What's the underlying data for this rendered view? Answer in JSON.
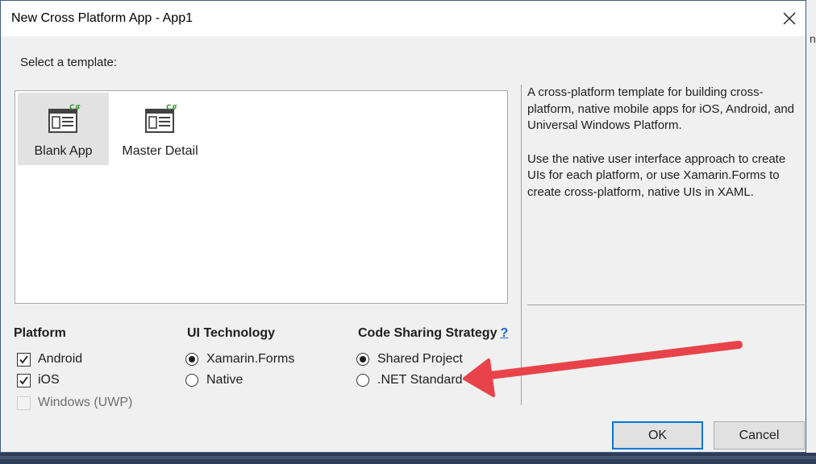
{
  "dialog": {
    "title": "New Cross Platform App - App1",
    "select_label": "Select a template:"
  },
  "templates": [
    {
      "label": "Blank App",
      "icon": "csharp-template-icon",
      "selected": true
    },
    {
      "label": "Master Detail",
      "icon": "csharp-template-icon",
      "selected": false
    }
  ],
  "description": {
    "paragraph1": "A cross-platform template for building cross-platform, native mobile apps for iOS, Android, and Universal Windows Platform.",
    "paragraph2": "Use the native user interface approach to create UIs for each platform, or use Xamarin.Forms to create cross-platform, native UIs in XAML."
  },
  "platform": {
    "title": "Platform",
    "options": [
      {
        "label": "Android",
        "checked": true,
        "enabled": true
      },
      {
        "label": "iOS",
        "checked": true,
        "enabled": true
      },
      {
        "label": "Windows (UWP)",
        "checked": false,
        "enabled": false
      }
    ]
  },
  "ui_technology": {
    "title": "UI Technology",
    "options": [
      {
        "label": "Xamarin.Forms",
        "selected": true
      },
      {
        "label": "Native",
        "selected": false
      }
    ]
  },
  "code_sharing": {
    "title": "Code Sharing Strategy",
    "help": "?",
    "options": [
      {
        "label": "Shared Project",
        "selected": true
      },
      {
        "label": ".NET Standard",
        "selected": false
      }
    ]
  },
  "buttons": {
    "ok": "OK",
    "cancel": "Cancel"
  },
  "background": {
    "right_edge_text": "n"
  },
  "colors": {
    "annotation_arrow": "#e8434a",
    "link": "#1e64c8",
    "icon_green": "#3e9a3e"
  }
}
